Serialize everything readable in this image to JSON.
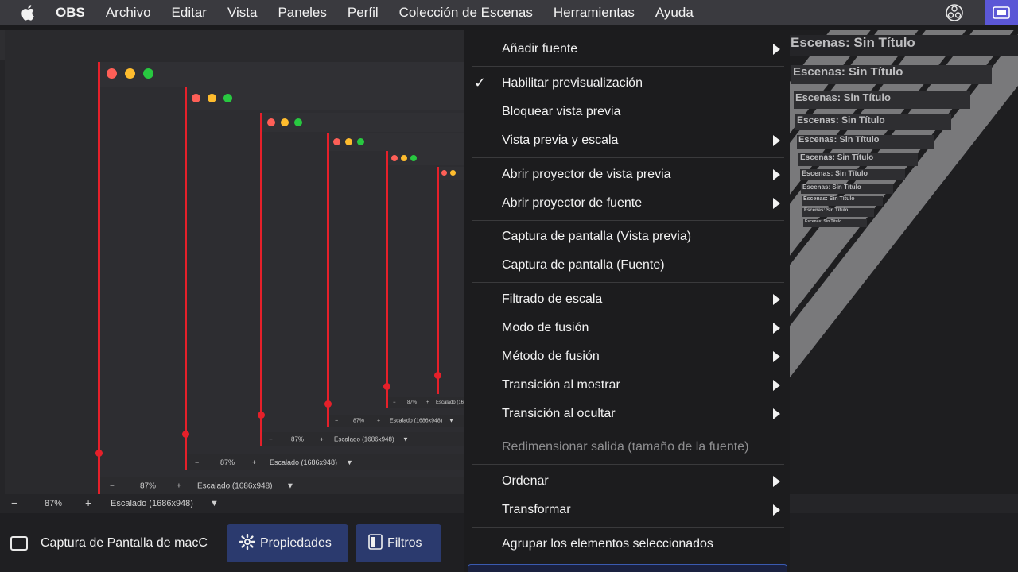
{
  "menubar": {
    "app_name": "OBS",
    "items": [
      "Archivo",
      "Editar",
      "Vista",
      "Paneles",
      "Perfil",
      "Colección de Escenas",
      "Herramientas",
      "Ayuda"
    ]
  },
  "scene_title": "Escenas: Sin Título",
  "preview_bar": {
    "minus": "−",
    "zoom": "87%",
    "plus": "+",
    "scale": "Escalado (1686x948)"
  },
  "source": {
    "label": "Captura de Pantalla de macC",
    "properties": "Propiedades",
    "filters": "Filtros"
  },
  "context_menu": {
    "items": [
      {
        "label": "Añadir fuente",
        "submenu": true
      },
      {
        "label": "Habilitar previsualización",
        "checked": true
      },
      {
        "label": "Bloquear vista previa"
      },
      {
        "label": "Vista previa y escala",
        "submenu": true
      },
      {
        "label": "Abrir proyector de vista previa",
        "submenu": true
      },
      {
        "label": "Abrir proyector de fuente",
        "submenu": true
      },
      {
        "label": "Captura de pantalla (Vista previa)"
      },
      {
        "label": "Captura de pantalla (Fuente)"
      },
      {
        "label": "Filtrado de escala",
        "submenu": true
      },
      {
        "label": "Modo de fusión",
        "submenu": true
      },
      {
        "label": "Método de fusión",
        "submenu": true
      },
      {
        "label": "Transición al mostrar",
        "submenu": true
      },
      {
        "label": "Transición al ocultar",
        "submenu": true
      },
      {
        "label": "Redimensionar salida (tamaño de la fuente)",
        "disabled": true
      },
      {
        "label": "Ordenar",
        "submenu": true
      },
      {
        "label": "Transformar",
        "submenu": true
      },
      {
        "label": "Agrupar los elementos seleccionados"
      }
    ]
  }
}
